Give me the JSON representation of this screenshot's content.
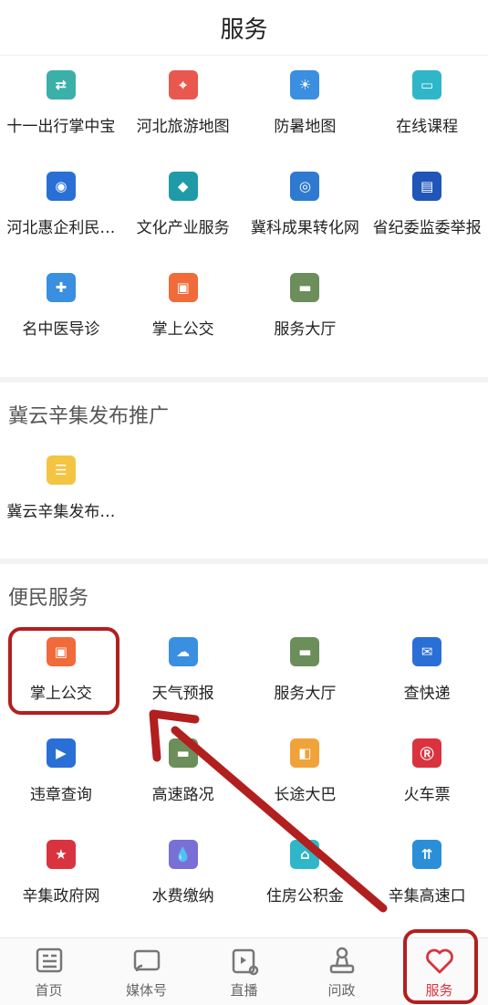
{
  "header": {
    "title": "服务"
  },
  "section_main": {
    "items": [
      {
        "label": "十一出行掌中宝",
        "icon": "travel-app-icon",
        "color": "#3bb0a8"
      },
      {
        "label": "河北旅游地图",
        "icon": "tourism-map-icon",
        "color": "#e8584f"
      },
      {
        "label": "防暑地图",
        "icon": "heat-map-icon",
        "color": "#3a8fe0"
      },
      {
        "label": "在线课程",
        "icon": "online-course-icon",
        "color": "#2fb6c9"
      },
      {
        "label": "河北惠企利民…",
        "icon": "enterprise-benefit-icon",
        "color": "#2a6fd6"
      },
      {
        "label": "文化产业服务",
        "icon": "culture-industry-icon",
        "color": "#1f9aa8"
      },
      {
        "label": "冀科成果转化网",
        "icon": "tech-transfer-icon",
        "color": "#2e7ad1"
      },
      {
        "label": "省纪委监委举报",
        "icon": "report-icon",
        "color": "#1f56b8"
      },
      {
        "label": "名中医导诊",
        "icon": "doctor-icon",
        "color": "#3a8fe0"
      },
      {
        "label": "掌上公交",
        "icon": "bus-icon",
        "color": "#f06a3a"
      },
      {
        "label": "服务大厅",
        "icon": "service-hall-icon",
        "color": "#6b8e5a"
      }
    ]
  },
  "section_promo": {
    "title": "冀云辛集发布推广",
    "items": [
      {
        "label": "冀云辛集发布…",
        "icon": "clipboard-icon",
        "color": "#f3c542"
      }
    ]
  },
  "section_convenience": {
    "title": "便民服务",
    "items": [
      {
        "label": "掌上公交",
        "icon": "bus-icon",
        "color": "#f06a3a"
      },
      {
        "label": "天气预报",
        "icon": "weather-icon",
        "color": "#3a8fe0"
      },
      {
        "label": "服务大厅",
        "icon": "service-hall-icon",
        "color": "#6b8e5a"
      },
      {
        "label": "查快递",
        "icon": "express-icon",
        "color": "#2a6fd6"
      },
      {
        "label": "违章查询",
        "icon": "violation-icon",
        "color": "#2a6fd6"
      },
      {
        "label": "高速路况",
        "icon": "highway-traffic-icon",
        "color": "#6b8e5a"
      },
      {
        "label": "长途大巴",
        "icon": "coach-bus-icon",
        "color": "#f0a33a"
      },
      {
        "label": "火车票",
        "icon": "train-icon",
        "color": "#d9333f"
      },
      {
        "label": "辛集政府网",
        "icon": "government-emblem-icon",
        "color": "#d9333f"
      },
      {
        "label": "水费缴纳",
        "icon": "water-fee-icon",
        "color": "#7a6fd6"
      },
      {
        "label": "住房公积金",
        "icon": "housing-fund-icon",
        "color": "#2fb6c9"
      },
      {
        "label": "辛集高速口",
        "icon": "highway-exit-icon",
        "color": "#2a8fd6"
      }
    ]
  },
  "tabbar": {
    "tabs": [
      {
        "label": "首页",
        "icon": "home-news-icon"
      },
      {
        "label": "媒体号",
        "icon": "cast-icon"
      },
      {
        "label": "直播",
        "icon": "live-video-icon"
      },
      {
        "label": "问政",
        "icon": "stamp-icon"
      },
      {
        "label": "服务",
        "icon": "heart-icon",
        "active": true
      }
    ]
  },
  "colors": {
    "accent": "#d9333f",
    "highlight": "#b21f1f"
  }
}
